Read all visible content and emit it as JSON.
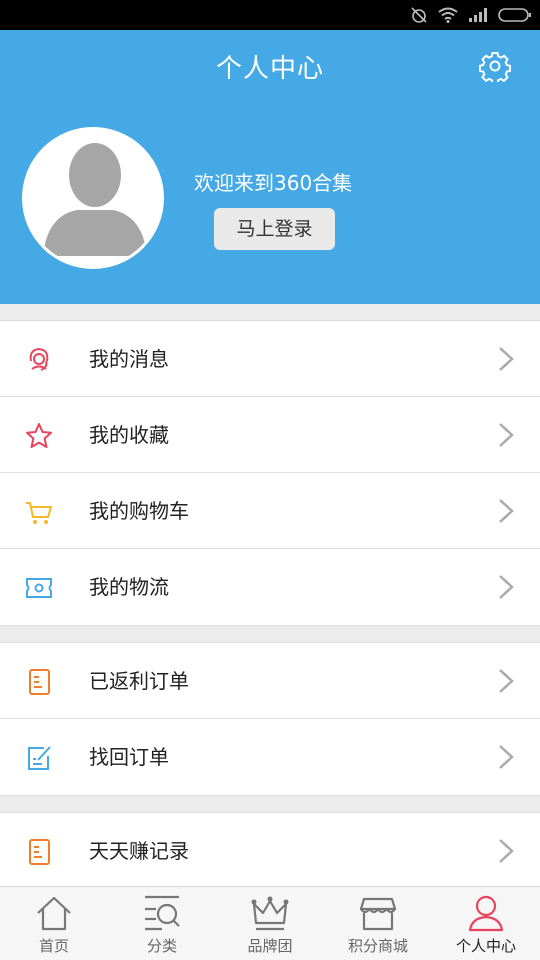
{
  "header": {
    "title": "个人中心",
    "welcome": "欢迎来到360合集",
    "login_label": "马上登录"
  },
  "menu": {
    "group1": [
      {
        "label": "我的消息",
        "icon": "message-icon"
      },
      {
        "label": "我的收藏",
        "icon": "star-icon"
      },
      {
        "label": "我的购物车",
        "icon": "cart-icon"
      },
      {
        "label": "我的物流",
        "icon": "logistics-icon"
      }
    ],
    "group2": [
      {
        "label": "已返利订单",
        "icon": "order-icon"
      },
      {
        "label": "找回订单",
        "icon": "edit-order-icon"
      }
    ],
    "group3": [
      {
        "label": "天天赚记录",
        "icon": "record-icon"
      }
    ]
  },
  "tabs": [
    {
      "label": "首页",
      "icon": "home-icon"
    },
    {
      "label": "分类",
      "icon": "category-search-icon"
    },
    {
      "label": "品牌团",
      "icon": "crown-icon"
    },
    {
      "label": "积分商城",
      "icon": "store-icon"
    },
    {
      "label": "个人中心",
      "icon": "person-icon",
      "active": true
    }
  ],
  "colors": {
    "header_bg": "#45a9e6",
    "active_tab": "#e8445b",
    "icon_red": "#e8445b",
    "icon_yellow": "#f2b827",
    "icon_blue": "#45a9e6",
    "icon_orange": "#f07d2c"
  }
}
